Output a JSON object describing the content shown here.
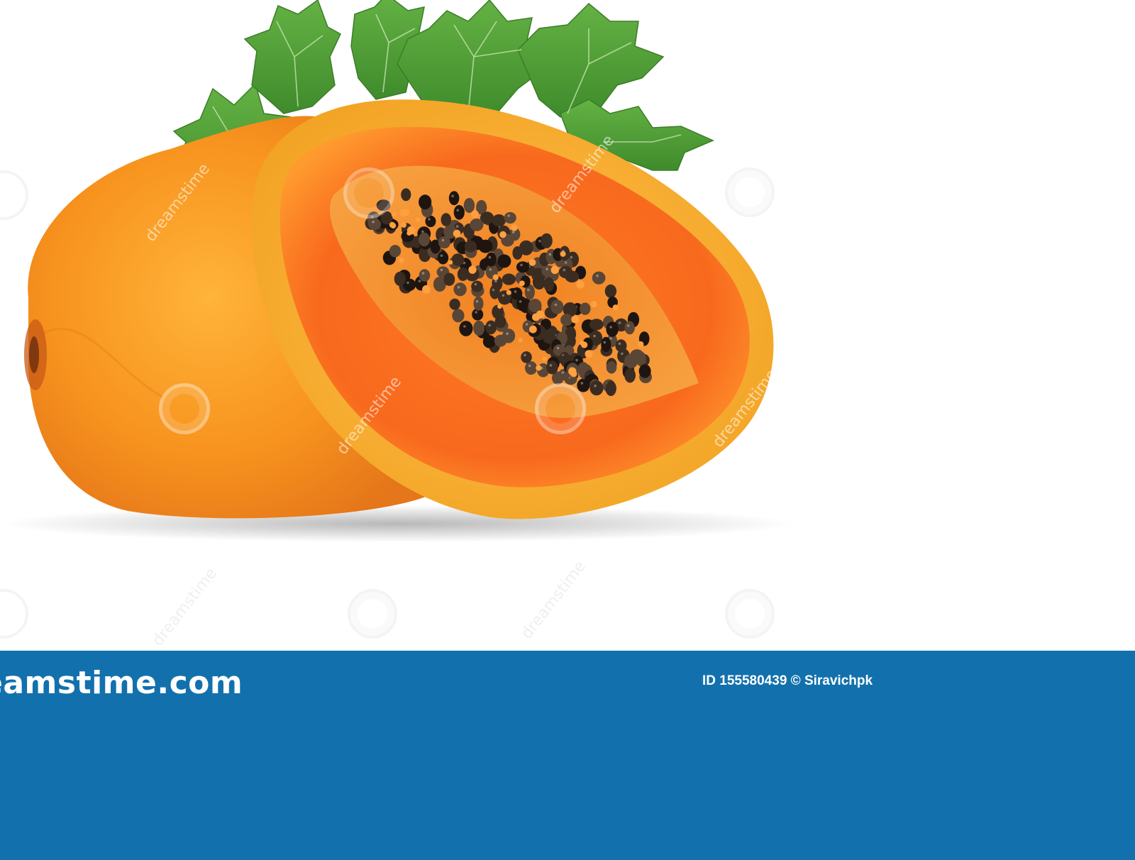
{
  "image": {
    "subject": "papaya",
    "background_color": "#ffffff"
  },
  "colors": {
    "footer": "#1271ad",
    "fruit_skin": "#f7931e",
    "fruit_flesh": "#f36d21",
    "seeds": "#3b2c22",
    "leaf": "#4f9b36",
    "text": "#ffffff"
  },
  "watermark": {
    "word": "dreamstime",
    "icon": "spiral-icon"
  },
  "footer": {
    "brand": "eamstime.com",
    "credit": "ID 155580439 © Siravichpk"
  }
}
